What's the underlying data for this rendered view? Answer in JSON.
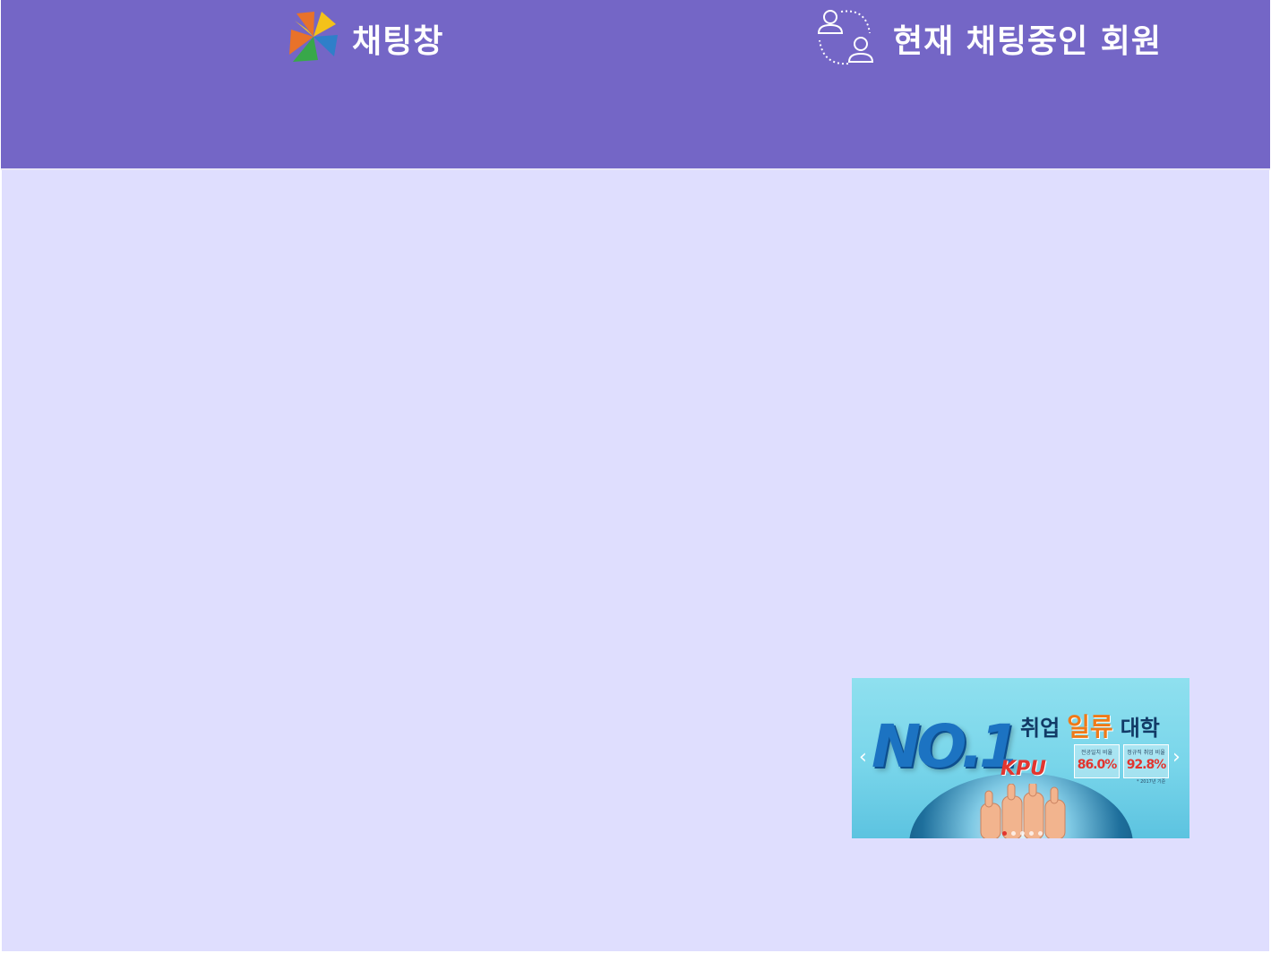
{
  "header": {
    "title": "채팅창",
    "logo_icon": "pinwheel-logo-icon",
    "members_label": "현재 채팅중인 회원",
    "members_icon": "users-exchange-icon",
    "background_color": "#7466c6"
  },
  "main": {
    "background_color": "#dfdefe"
  },
  "banner": {
    "big_text": "NO.1",
    "brand": "KPU",
    "headline_prefix": "취업",
    "headline_accent": "일류",
    "headline_suffix": "대학",
    "stats": [
      {
        "label": "전공일치 비율",
        "value": "86.0%"
      },
      {
        "label": "정규직 취업 비율",
        "value": "92.8%"
      }
    ],
    "note": "* 2017년 기준",
    "prev_arrow": "‹",
    "next_arrow": "›",
    "slide_count": 5,
    "active_slide": 1
  }
}
